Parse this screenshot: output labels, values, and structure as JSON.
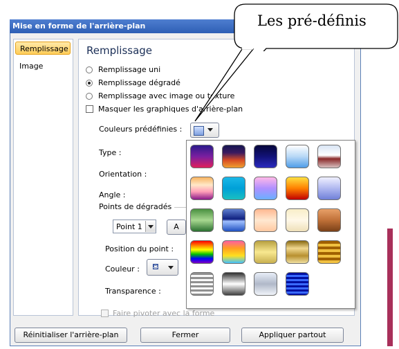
{
  "window": {
    "title": "Mise en forme de l'arrière-plan"
  },
  "nav": {
    "items": [
      "Remplissage",
      "Image"
    ]
  },
  "panel": {
    "title": "Remplissage",
    "options": [
      {
        "label": "Remplissage uni",
        "checked": false
      },
      {
        "label": "Remplissage dégradé",
        "checked": true
      },
      {
        "label": "Remplissage avec image ou texture",
        "checked": false
      }
    ],
    "hide_graphics": "Masquer les graphiques d'arrière-plan",
    "preset_colors": "Couleurs prédéfinies :",
    "type": "Type :",
    "orientation": "Orientation :",
    "angle": "Angle :",
    "gradient_stops": "Points de dégradés",
    "stop_select": "Point 1",
    "add_button": "A",
    "stop_position": "Position du point :",
    "color": "Couleur :",
    "transparency": "Transparence :",
    "rotate_with_shape": "Faire pivoter avec la forme"
  },
  "callout": {
    "text": "Les pré-définis"
  },
  "gallery": {
    "presets": [
      "linear-gradient(#2b1a8a,#7a1fa0,#e0205c)",
      "linear-gradient(#151550,#3b1a60,#d84c24,#f0a030)",
      "linear-gradient(#06063a,#121278,#2a2abe)",
      "linear-gradient(#ffffff,#b8d8f6,#4f9de8)",
      "linear-gradient(#d8e4f4,#ffffff 45%,#8a2a2a 60%,#d8c0c0)",
      "linear-gradient(#f8b460,#ffe8c8 35%,#ff9fb8 65%,#8a1a8a)",
      "linear-gradient(#1ab8e8,#00a0d8,#1ac0c0)",
      "linear-gradient(#ffb8e8,#b090ff,#6ab0ff)",
      "linear-gradient(#ffe040,#ff8000,#c00000)",
      "linear-gradient(#f0f0ff,#b0b8f0,#7080d8)",
      "linear-gradient(#4a9040,#a8d890,#2a7030)",
      "linear-gradient(#6080d0,#102080 45%,#a0c0ff 55%,#2050c0)",
      "linear-gradient(#ffb890,#ffe8d0,#ffc8a0)",
      "linear-gradient(#f8eec8,#fff8e8,#efe0b8)",
      "linear-gradient(#e8a068,#c07038,#7a4018)",
      "linear-gradient(#ff0000,#ff8000,#ffff00,#00c000,#0000ff,#8000c0)",
      "linear-gradient(#ff60a0,#ffa020,#ffe020,#40c0ff)",
      "linear-gradient(#b8a040,#f8e890,#c8b050)",
      "linear-gradient(#8a6a10,#f0d890,#b89030,#f0e0a0)",
      "repeating-linear-gradient(#a06000 0 4px,#f0c040 4px 8px)",
      "repeating-linear-gradient(#909090 0 3px,#f8f8f8 3px 6px)",
      "linear-gradient(#303030,#ffffff 50%,#404040)",
      "linear-gradient(#e8eef8,#b0b8c8 50%,#f0f4fa)",
      "repeating-linear-gradient(#0010a0 0 3px,#3a6aff 3px 6px)"
    ]
  },
  "buttons": {
    "reset": "Réinitialiser l'arrière-plan",
    "close": "Fermer",
    "apply_all": "Appliquer partout"
  }
}
